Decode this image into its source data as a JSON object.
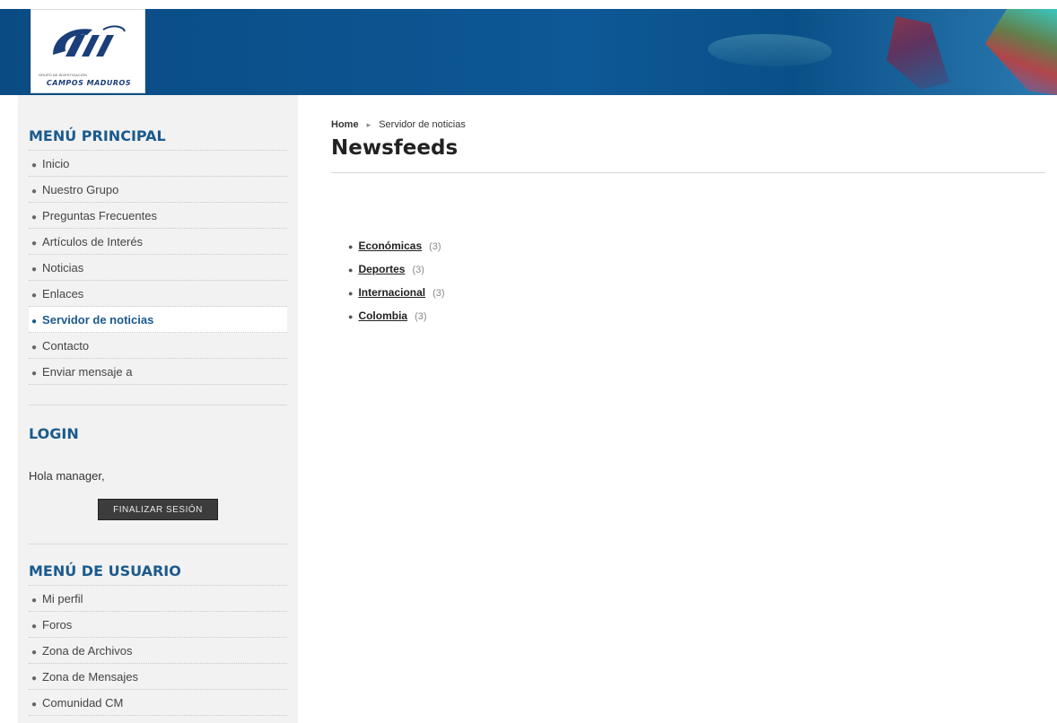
{
  "header": {
    "logo_text": "CAMPOS MADUROS",
    "logo_sub": "GRUPO DE INVESTIGACIÓN"
  },
  "sidebar": {
    "main_menu": {
      "heading": "MENÚ PRINCIPAL",
      "items": [
        {
          "label": "Inicio"
        },
        {
          "label": "Nuestro Grupo"
        },
        {
          "label": "Preguntas Frecuentes"
        },
        {
          "label": "Artículos de Interés"
        },
        {
          "label": "Noticias"
        },
        {
          "label": "Enlaces"
        },
        {
          "label": "Servidor de noticias",
          "active": true
        },
        {
          "label": "Contacto"
        },
        {
          "label": "Enviar mensaje a"
        }
      ]
    },
    "login": {
      "heading": "LOGIN",
      "greeting": "Hola manager,",
      "logout_label": "FINALIZAR SESIÓN"
    },
    "user_menu": {
      "heading": "MENÚ DE USUARIO",
      "items": [
        {
          "label": "Mi perfil"
        },
        {
          "label": "Foros"
        },
        {
          "label": "Zona de Archivos"
        },
        {
          "label": "Zona de Mensajes"
        },
        {
          "label": "Comunidad CM"
        }
      ]
    }
  },
  "main": {
    "breadcrumb": {
      "home": "Home",
      "current": "Servidor de noticias"
    },
    "title": "Newsfeeds",
    "feeds": [
      {
        "label": "Económicas",
        "count": "(3)"
      },
      {
        "label": "Deportes",
        "count": "(3)"
      },
      {
        "label": "Internacional",
        "count": "(3)"
      },
      {
        "label": "Colombia",
        "count": "(3)"
      }
    ]
  },
  "colors": {
    "header_blue": "#0d5896",
    "heading_blue": "#1b5a8e",
    "sidebar_bg": "#f2f2f2"
  }
}
